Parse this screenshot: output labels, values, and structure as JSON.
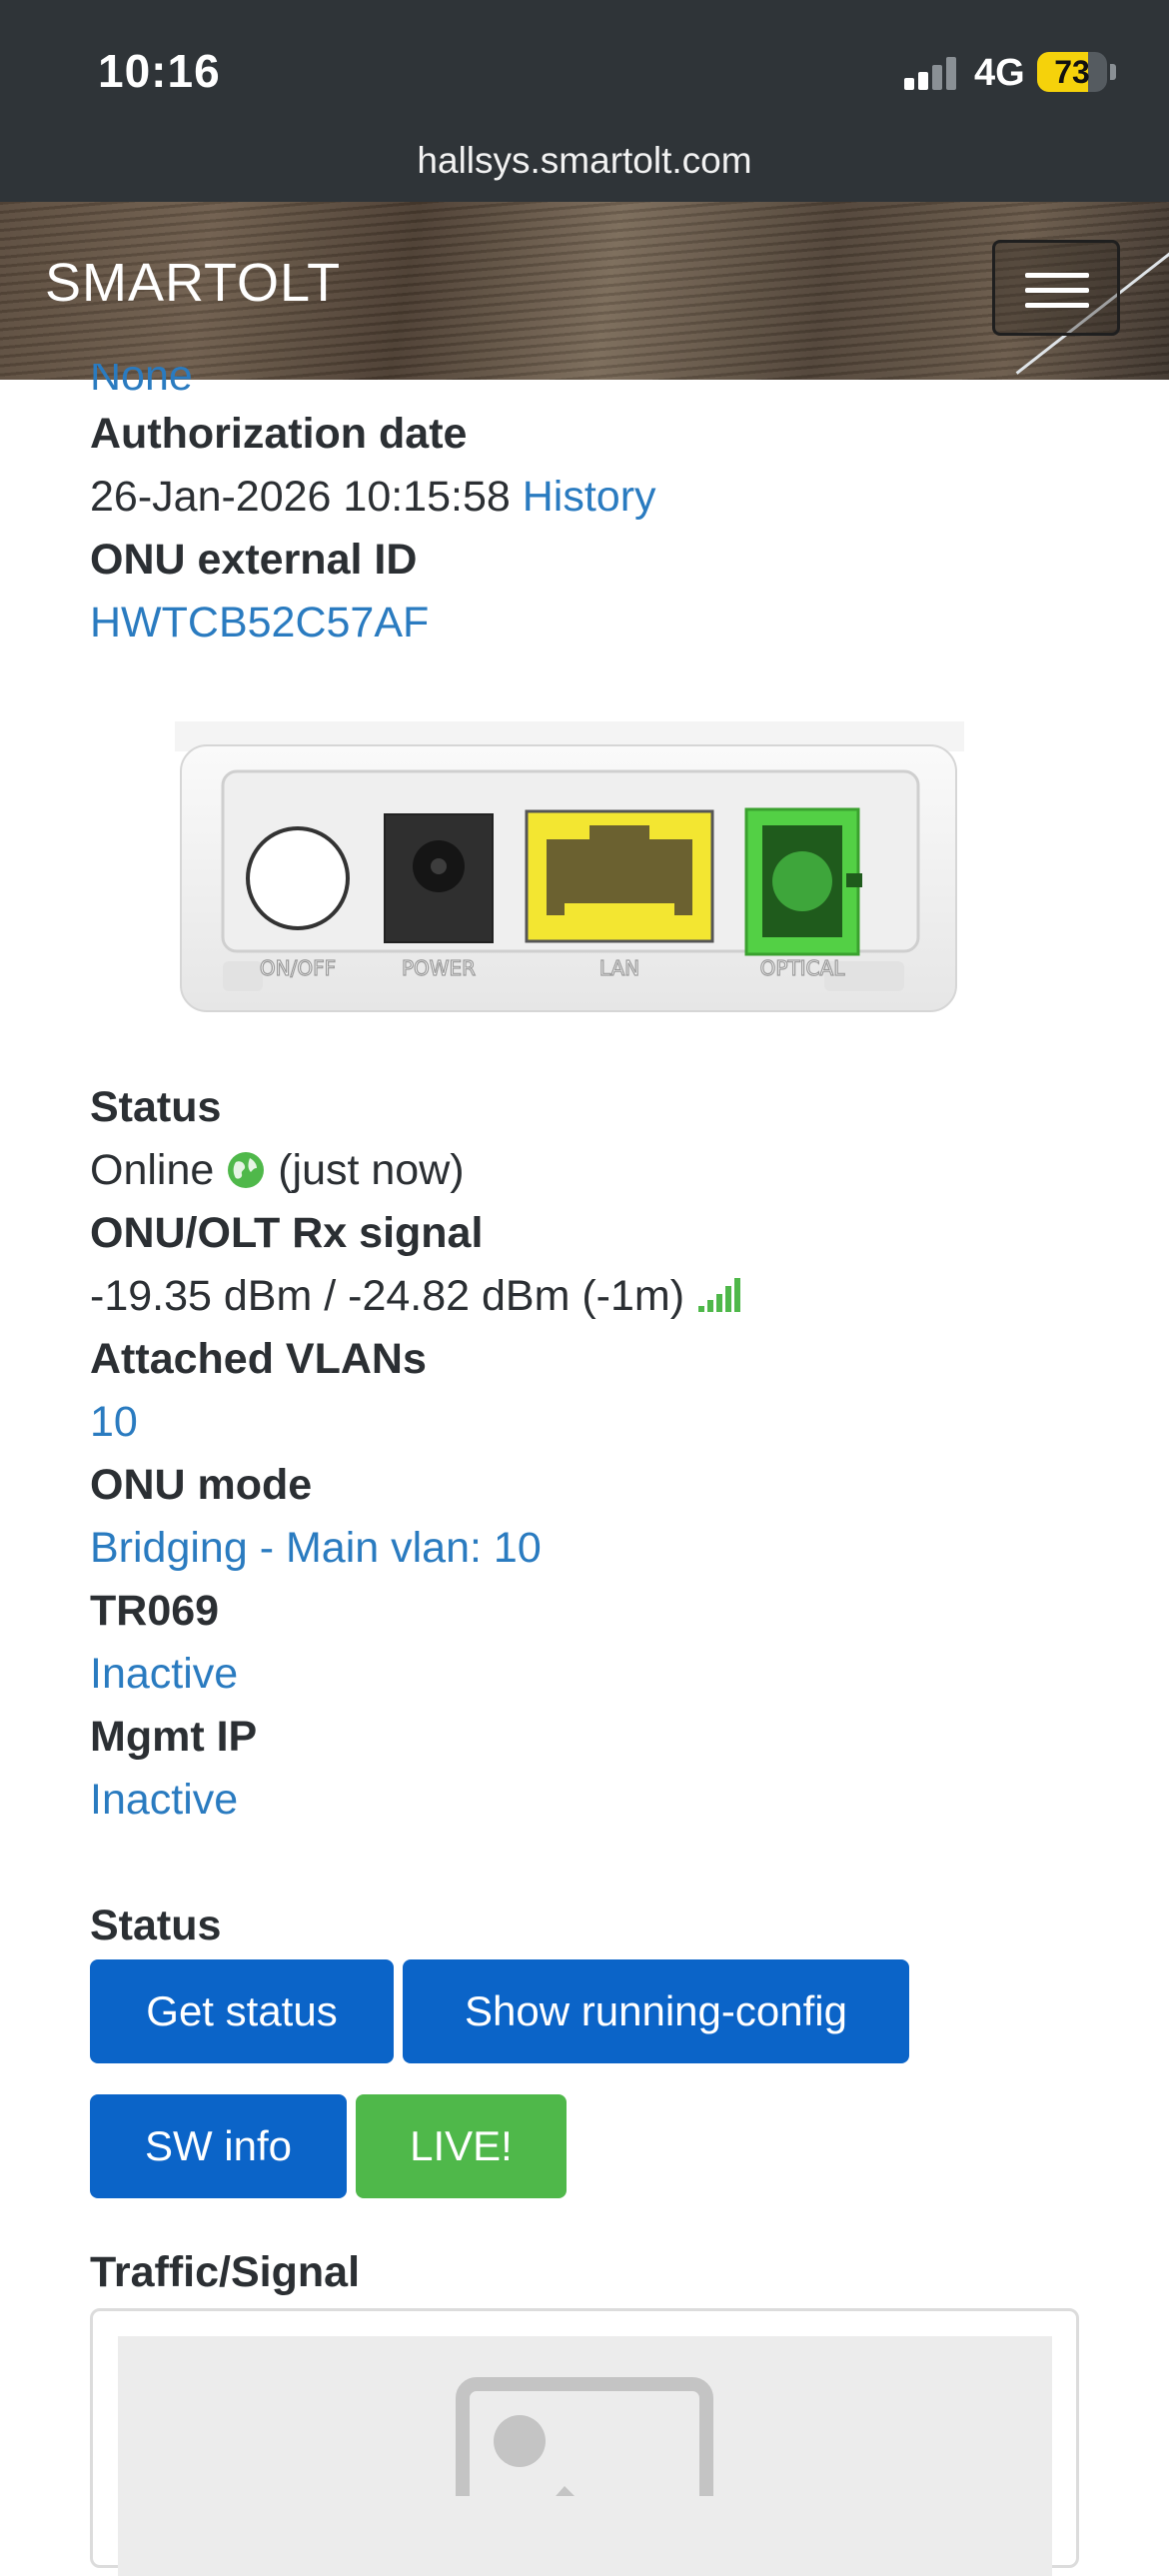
{
  "status_bar": {
    "time": "10:16",
    "network": "4G",
    "battery_percent": "73"
  },
  "url_bar": {
    "url": "hallsys.smartolt.com"
  },
  "navbar": {
    "brand": "SMARTOLT",
    "menu_icon": "hamburger-menu-icon"
  },
  "details": {
    "cut_off_value": "None",
    "authorization_date_label": "Authorization date",
    "authorization_date_value": "26-Jan-2026 10:15:58",
    "history_link": "History",
    "external_id_label": "ONU external ID",
    "external_id_value": "HWTCB52C57AF",
    "device_ports": [
      "ON/OFF",
      "POWER",
      "LAN",
      "OPTICAL"
    ],
    "status_label": "Status",
    "status_value": "Online",
    "status_icon": "globe-icon",
    "status_time": "(just now)",
    "rx_signal_label": "ONU/OLT Rx signal",
    "rx_signal_value": "-19.35 dBm / -24.82 dBm (-1m)",
    "signal_icon": "signal-bars-icon",
    "vlans_label": "Attached VLANs",
    "vlans_value": "10",
    "mode_label": "ONU mode",
    "mode_value": "Bridging - Main vlan: 10",
    "tr069_label": "TR069",
    "tr069_value": "Inactive",
    "mgmt_ip_label": "Mgmt IP",
    "mgmt_ip_value": "Inactive"
  },
  "actions": {
    "section_label": "Status",
    "get_status": "Get status",
    "show_running_config": "Show running-config",
    "sw_info": "SW info",
    "live": "LIVE!"
  },
  "traffic": {
    "label": "Traffic/Signal",
    "image_icon": "image-placeholder-icon"
  },
  "colors": {
    "link": "#2a7bc0",
    "button_primary": "#0b64c8",
    "button_success": "#4fb84a",
    "status_online": "#4fb84a",
    "status_bar_bg": "#2f3438"
  }
}
